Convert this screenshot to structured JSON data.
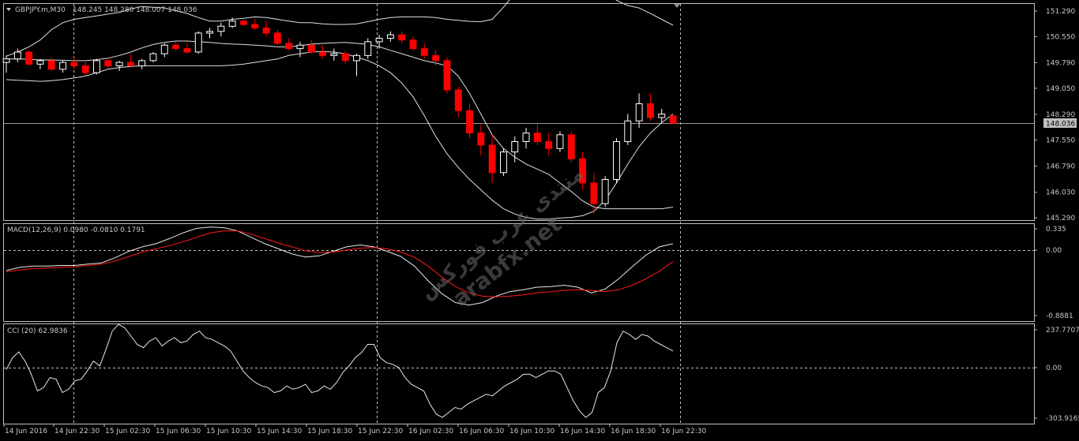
{
  "colors": {
    "background": "#000000",
    "grid": "#c0c0c0",
    "text": "#c8c8c8",
    "bull": "#ffffff",
    "bear": "#ff0000",
    "bands": "#e0e0e0",
    "macd_main": "#e8e8e8",
    "macd_signal": "#ff1a1a",
    "cci": "#e8e8e8",
    "current_box": "#c0c0c0"
  },
  "header": {
    "symbol_label": "GBPJPY.m,M30",
    "ohlc_label": "148.245 148.280 148.007 148.036",
    "dropdown_icon": "triangle-down-icon"
  },
  "watermark": {
    "line1": "منتدى عرب فوركس",
    "line2": "arabfx.net"
  },
  "chart_data": [
    {
      "type": "candlestick",
      "name": "price",
      "title": "GBPJPY.m,M30",
      "y_ticks": [
        151.29,
        150.55,
        149.79,
        149.05,
        148.29,
        147.55,
        146.79,
        146.03,
        145.29
      ],
      "y_tick_labels": [
        "151.290",
        "150.550",
        "149.790",
        "149.050",
        "148.290",
        "147.550",
        "146.790",
        "146.030",
        "145.290"
      ],
      "current_price": 148.036,
      "current_price_label": "148.036",
      "bollinger": {
        "upper": [
          149.98,
          150.1,
          150.25,
          150.45,
          150.75,
          150.95,
          151.05,
          151.1,
          151.15,
          151.2,
          151.25,
          151.35,
          151.42,
          151.4,
          151.38,
          151.3,
          151.22,
          151.1,
          151.0,
          151.0,
          151.05,
          151.08,
          151.12,
          151.1,
          151.05,
          151.0,
          150.95,
          150.95,
          150.92,
          150.9,
          150.9,
          150.92,
          150.98,
          151.05,
          151.1,
          151.12,
          151.12,
          151.12,
          151.1,
          151.05,
          151.02,
          150.99,
          150.98,
          151.05,
          151.4,
          151.8,
          152.1,
          152.3,
          152.4,
          152.45,
          152.45,
          152.4,
          152.2,
          151.9,
          151.6,
          151.45,
          151.38,
          151.22,
          151.05,
          150.88
        ],
        "middle": [
          149.9,
          149.9,
          149.89,
          149.87,
          149.87,
          149.86,
          149.85,
          149.85,
          149.88,
          149.92,
          150.0,
          150.1,
          150.22,
          150.32,
          150.38,
          150.42,
          150.42,
          150.4,
          150.38,
          150.35,
          150.33,
          150.32,
          150.3,
          150.28,
          150.25,
          150.25,
          150.28,
          150.33,
          150.35,
          150.37,
          150.38,
          150.35,
          150.32,
          150.25,
          150.15,
          150.05,
          149.95,
          149.85,
          149.78,
          149.7,
          149.4,
          148.9,
          148.3,
          147.7,
          147.3,
          147.05,
          146.85,
          146.7,
          146.55,
          146.3,
          146.05,
          145.78,
          145.6,
          145.55,
          145.55,
          145.55,
          145.55,
          145.55,
          145.55,
          145.6
        ],
        "lower": [
          149.3,
          149.28,
          149.27,
          149.25,
          149.27,
          149.3,
          149.35,
          149.4,
          149.5,
          149.6,
          149.65,
          149.68,
          149.7,
          149.7,
          149.7,
          149.7,
          149.7,
          149.7,
          149.7,
          149.7,
          149.72,
          149.75,
          149.8,
          149.85,
          149.9,
          150.0,
          150.05,
          150.1,
          150.12,
          150.1,
          150.05,
          149.95,
          149.85,
          149.7,
          149.5,
          149.2,
          148.8,
          148.25,
          147.65,
          147.15,
          146.75,
          146.4,
          146.1,
          145.8,
          145.55,
          145.4,
          145.3,
          145.25,
          145.25,
          145.28,
          145.3,
          145.35,
          145.48,
          145.8,
          146.3,
          146.85,
          147.35,
          147.75,
          148.05,
          148.3
        ]
      },
      "ohlc": [
        [
          149.8,
          150.0,
          149.5,
          149.9
        ],
        [
          149.9,
          150.2,
          149.8,
          150.1
        ],
        [
          150.1,
          150.15,
          149.7,
          149.75
        ],
        [
          149.75,
          149.9,
          149.6,
          149.85
        ],
        [
          149.85,
          149.95,
          149.55,
          149.6
        ],
        [
          149.6,
          149.85,
          149.5,
          149.8
        ],
        [
          149.8,
          149.95,
          149.6,
          149.7
        ],
        [
          149.7,
          149.85,
          149.4,
          149.5
        ],
        [
          149.5,
          149.9,
          149.45,
          149.85
        ],
        [
          149.85,
          149.95,
          149.6,
          149.7
        ],
        [
          149.7,
          149.85,
          149.55,
          149.8
        ],
        [
          149.8,
          150.05,
          149.75,
          149.7
        ],
        [
          149.7,
          149.9,
          149.6,
          149.85
        ],
        [
          149.85,
          150.1,
          149.8,
          150.05
        ],
        [
          150.05,
          150.35,
          149.95,
          150.3
        ],
        [
          150.3,
          150.4,
          150.15,
          150.2
        ],
        [
          150.2,
          150.35,
          150.05,
          150.1
        ],
        [
          150.1,
          150.7,
          150.05,
          150.65
        ],
        [
          150.65,
          150.8,
          150.5,
          150.7
        ],
        [
          150.7,
          150.95,
          150.55,
          150.85
        ],
        [
          150.85,
          151.1,
          150.8,
          151.0
        ],
        [
          151.0,
          151.05,
          150.85,
          150.9
        ],
        [
          150.9,
          151.05,
          150.75,
          150.8
        ],
        [
          150.8,
          151.0,
          150.55,
          150.65
        ],
        [
          150.65,
          150.75,
          150.3,
          150.35
        ],
        [
          150.35,
          150.5,
          150.15,
          150.2
        ],
        [
          150.2,
          150.4,
          149.95,
          150.3
        ],
        [
          150.3,
          150.45,
          150.05,
          150.1
        ],
        [
          150.1,
          150.3,
          149.9,
          150.0
        ],
        [
          150.0,
          150.2,
          149.85,
          150.05
        ],
        [
          150.05,
          150.15,
          149.75,
          149.85
        ],
        [
          149.85,
          150.05,
          149.4,
          150.0
        ],
        [
          150.0,
          150.5,
          149.9,
          150.4
        ],
        [
          150.4,
          150.6,
          150.2,
          150.5
        ],
        [
          150.5,
          150.7,
          150.4,
          150.6
        ],
        [
          150.6,
          150.7,
          150.35,
          150.45
        ],
        [
          150.45,
          150.55,
          150.15,
          150.2
        ],
        [
          150.2,
          150.35,
          149.9,
          150.0
        ],
        [
          150.0,
          150.15,
          149.7,
          149.85
        ],
        [
          149.85,
          149.95,
          148.9,
          149.0
        ],
        [
          149.0,
          149.1,
          148.2,
          148.4
        ],
        [
          148.4,
          148.6,
          147.6,
          147.75
        ],
        [
          147.75,
          148.0,
          147.1,
          147.4
        ],
        [
          147.4,
          147.7,
          146.3,
          146.6
        ],
        [
          146.6,
          147.3,
          146.5,
          147.2
        ],
        [
          147.2,
          147.65,
          146.9,
          147.5
        ],
        [
          147.5,
          147.9,
          147.3,
          147.75
        ],
        [
          147.75,
          148.0,
          147.4,
          147.5
        ],
        [
          147.5,
          147.75,
          147.1,
          147.3
        ],
        [
          147.3,
          147.8,
          147.2,
          147.7
        ],
        [
          147.7,
          147.8,
          146.9,
          147.0
        ],
        [
          147.0,
          147.2,
          146.1,
          146.3
        ],
        [
          146.3,
          146.6,
          145.4,
          145.7
        ],
        [
          145.7,
          146.5,
          145.6,
          146.4
        ],
        [
          146.4,
          147.6,
          146.3,
          147.5
        ],
        [
          147.5,
          148.3,
          147.4,
          148.1
        ],
        [
          148.1,
          148.9,
          147.9,
          148.6
        ],
        [
          148.6,
          148.9,
          148.1,
          148.2
        ],
        [
          148.2,
          148.45,
          148.05,
          148.3
        ],
        [
          148.245,
          148.28,
          148.007,
          148.036
        ]
      ]
    },
    {
      "type": "line",
      "name": "macd",
      "title": "MACD(12,26,9) 0.0980 -0.0810 0.1791",
      "y_ticks": [
        0.335,
        0.0,
        -0.8881
      ],
      "y_tick_labels": [
        "0.335",
        "0.00",
        "-0.8881"
      ],
      "series": [
        {
          "values": [
            -0.32,
            -0.27,
            -0.25,
            -0.25,
            -0.24,
            -0.24,
            -0.22,
            -0.2,
            -0.12,
            -0.02,
            0.05,
            0.1,
            0.18,
            0.27,
            0.34,
            0.36,
            0.35,
            0.3,
            0.2,
            0.1,
            0.02,
            -0.06,
            -0.11,
            -0.09,
            -0.02,
            0.05,
            0.08,
            0.05,
            -0.02,
            -0.1,
            -0.25,
            -0.48,
            -0.68,
            -0.82,
            -0.86,
            -0.82,
            -0.72,
            -0.65,
            -0.62,
            -0.58,
            -0.57,
            -0.55,
            -0.58,
            -0.67,
            -0.61,
            -0.45,
            -0.26,
            -0.08,
            0.05,
            0.1
          ]
        },
        {
          "values": [
            -0.34,
            -0.31,
            -0.29,
            -0.28,
            -0.27,
            -0.26,
            -0.24,
            -0.22,
            -0.17,
            -0.1,
            -0.03,
            0.02,
            0.07,
            0.13,
            0.2,
            0.27,
            0.3,
            0.3,
            0.25,
            0.18,
            0.11,
            0.05,
            -0.01,
            -0.04,
            -0.03,
            0.0,
            0.03,
            0.04,
            0.02,
            -0.03,
            -0.11,
            -0.25,
            -0.42,
            -0.57,
            -0.67,
            -0.72,
            -0.73,
            -0.72,
            -0.7,
            -0.67,
            -0.65,
            -0.63,
            -0.62,
            -0.63,
            -0.65,
            -0.62,
            -0.55,
            -0.45,
            -0.33,
            -0.18
          ]
        }
      ]
    },
    {
      "type": "line",
      "name": "cci",
      "title": "CCI (20) 62.9836",
      "y_ticks": [
        237.7707,
        0.0,
        -303.9165
      ],
      "y_tick_labels": [
        "237.7707",
        "0.00",
        "-303.9165"
      ],
      "values": [
        -12,
        60,
        95,
        40,
        -40,
        -140,
        -120,
        -60,
        -70,
        -150,
        -130,
        -80,
        -70,
        -20,
        40,
        10,
        110,
        220,
        260,
        240,
        190,
        140,
        120,
        160,
        180,
        130,
        160,
        180,
        150,
        160,
        200,
        220,
        180,
        170,
        150,
        130,
        100,
        40,
        -20,
        -60,
        -90,
        -110,
        -120,
        -150,
        -140,
        -110,
        -130,
        -120,
        -100,
        -150,
        -140,
        -110,
        -130,
        -90,
        -30,
        10,
        60,
        90,
        140,
        140,
        60,
        30,
        20,
        0,
        -60,
        -100,
        -120,
        -140,
        -220,
        -280,
        -300,
        -270,
        -240,
        -250,
        -220,
        -200,
        -180,
        -160,
        -170,
        -140,
        -110,
        -90,
        -70,
        -40,
        -40,
        -60,
        -40,
        -20,
        -20,
        -40,
        -120,
        -200,
        -260,
        -300,
        -270,
        -150,
        -120,
        -20,
        150,
        220,
        200,
        170,
        200,
        190,
        160,
        140,
        120,
        100
      ]
    }
  ],
  "x_axis": {
    "labels": [
      "14 Jun 2016",
      "14 Jun 22:30",
      "15 Jun 02:30",
      "15 Jun 06:30",
      "15 Jun 10:30",
      "15 Jun 14:30",
      "15 Jun 18:30",
      "15 Jun 22:30",
      "16 Jun 02:30",
      "16 Jun 06:30",
      "16 Jun 10:30",
      "16 Jun 14:30",
      "16 Jun 18:30",
      "16 Jun 22:30"
    ]
  }
}
